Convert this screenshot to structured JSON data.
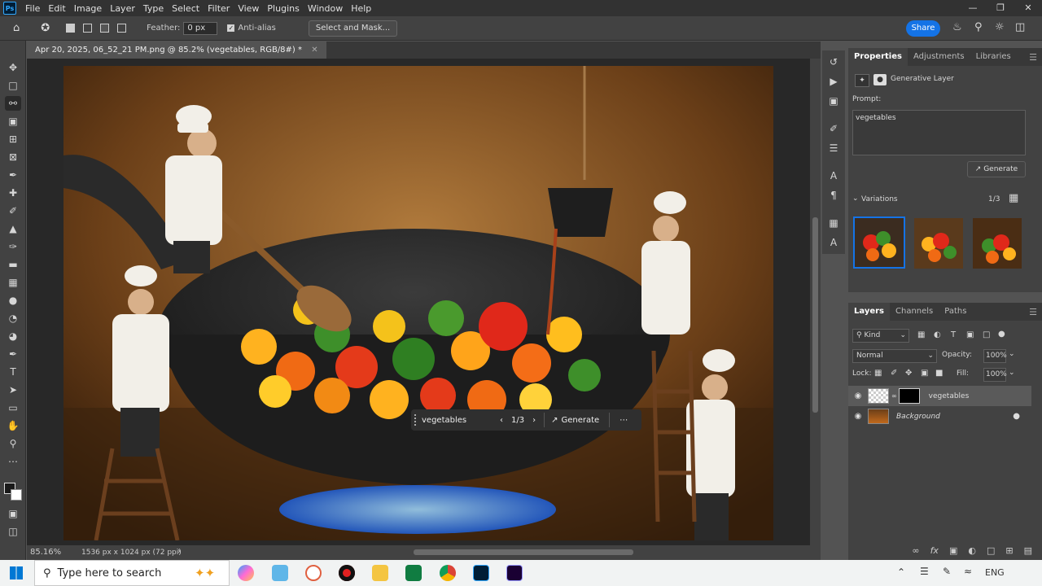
{
  "menu": [
    "File",
    "Edit",
    "Image",
    "Layer",
    "Type",
    "Select",
    "Filter",
    "View",
    "Plugins",
    "Window",
    "Help"
  ],
  "app_logo": "Ps",
  "options": {
    "feather_label": "Feather:",
    "feather_value": "0 px",
    "antialias_label": "Anti-alias",
    "select_mask": "Select and Mask...",
    "share": "Share"
  },
  "document": {
    "tab_title": "Apr 20, 2025, 06_52_21 PM.png @ 85.2% (vegetables, RGB/8#) *",
    "zoom": "85.16%",
    "size_info": "1536 px x 1024 px (72 ppi)"
  },
  "contextual_bar": {
    "prompt": "vegetables",
    "counter": "1/3",
    "generate": "Generate"
  },
  "properties": {
    "tabs": [
      "Properties",
      "Adjustments",
      "Libraries"
    ],
    "layer_type": "Generative Layer",
    "prompt_label": "Prompt:",
    "prompt_value": "vegetables",
    "generate": "Generate",
    "variations_label": "Variations",
    "variations_count": "1/3"
  },
  "layers": {
    "tabs": [
      "Layers",
      "Channels",
      "Paths"
    ],
    "kind": "Kind",
    "blend": "Normal",
    "opacity_label": "Opacity:",
    "opacity": "100%",
    "lock_label": "Lock:",
    "fill_label": "Fill:",
    "fill": "100%",
    "items": [
      {
        "name": "vegetables",
        "selected": true
      },
      {
        "name": "Background",
        "selected": false
      }
    ]
  },
  "taskbar": {
    "search_placeholder": "Type here to search",
    "lang": "ENG"
  }
}
